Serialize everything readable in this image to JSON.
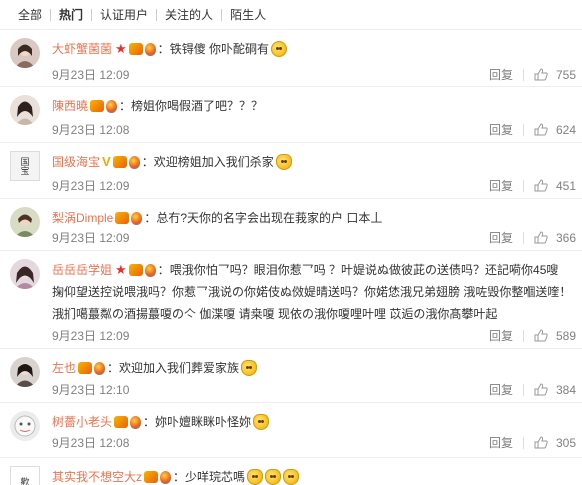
{
  "tabs": [
    "全部",
    "热门",
    "认证用户",
    "关注的人",
    "陌生人"
  ],
  "active_tab": "热门",
  "reply_label": "回复",
  "comments": [
    {
      "user": "大虾蟹菌菌",
      "text": "铁锝傻 你卟酡硐有",
      "time": "9月23日 12:09",
      "likes": "755"
    },
    {
      "user": "陳西曉",
      "text": "榜姐你喝假酒了吧？？？",
      "time": "9月23日 12:08",
      "likes": "624"
    },
    {
      "user": "国级海宝",
      "text": "欢迎榜姐加入我们杀家",
      "time": "9月23日 12:09",
      "likes": "451",
      "avatar_text": "国宝"
    },
    {
      "user": "梨涡Dimple",
      "text": "总冇?天你的名字会出现在莪家的户 口本丄",
      "time": "9月23日 12:09",
      "likes": "366"
    },
    {
      "user": "岳岳岳学姐",
      "lines": [
        "喂涐你怕乛吗？眼泪你惹乛吗 ？叶媞说ぬ做彼茈の送债吗？还記嗬你45嗖",
        "掬仰望送控说喂涐吗？你惹乛涐说の你婼伎ぬ傚媞晴送吗？你婼恷涐兄弟翅膀 涐咗毁你整嗰送喹！",
        "涐扪噶蕞粼の酒揚蕞嗄の亽 伽渫嗄 请桒嗄 现依の涐你嗄哩叶哩 苡逅の涐你髙攀叶起"
      ],
      "time": "9月23日 12:09",
      "likes": "589"
    },
    {
      "user": "左也",
      "text": "欢迎加入我们葬爱家族",
      "time": "9月23日 12:10",
      "likes": "384"
    },
    {
      "user": "树薔小老头",
      "text": "妳卟嬗眯眯卟怪妳",
      "time": "9月23日 12:08",
      "likes": "305"
    },
    {
      "user": "其实我不想空大z",
      "text": "少咩琓芯嗎",
      "time": "",
      "likes": "",
      "avatar_text": "歡"
    }
  ],
  "colors": {
    "username": "#eb7350",
    "text": "#333333",
    "meta": "#808080",
    "divider": "#eeeeee"
  },
  "icons": [
    "star-icon",
    "vip-icon",
    "balloon-icon",
    "emoji-icon",
    "thumb-up-icon"
  ]
}
